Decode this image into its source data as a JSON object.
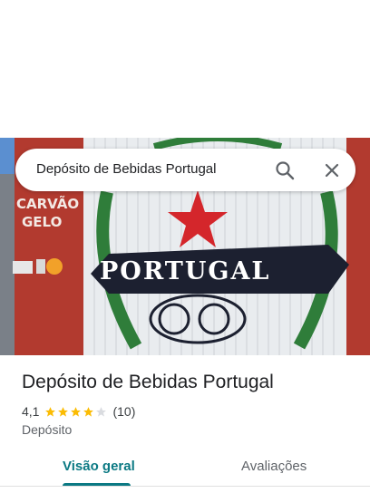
{
  "search": {
    "query": "Depósito de Bebidas Portugal"
  },
  "photo": {
    "sign_text": "PORTUGAL",
    "side_text_1": "CARVÃO",
    "side_text_2": "GELO",
    "colors": {
      "wall_red": "#b23a2f",
      "banner_navy": "#1c2030",
      "star_red": "#d4262b",
      "leaf_green": "#2f7d3a"
    }
  },
  "place": {
    "name": "Depósito de Bebidas Portugal",
    "rating": "4,1",
    "stars_filled": 4,
    "stars_total": 5,
    "review_count": "(10)",
    "category": "Depósito"
  },
  "tabs": [
    {
      "label": "Visão geral",
      "active": true
    },
    {
      "label": "Avaliações",
      "active": false
    }
  ],
  "colors": {
    "accent": "#0b7983",
    "star": "#fbbc04",
    "star_empty": "#dadce0"
  }
}
